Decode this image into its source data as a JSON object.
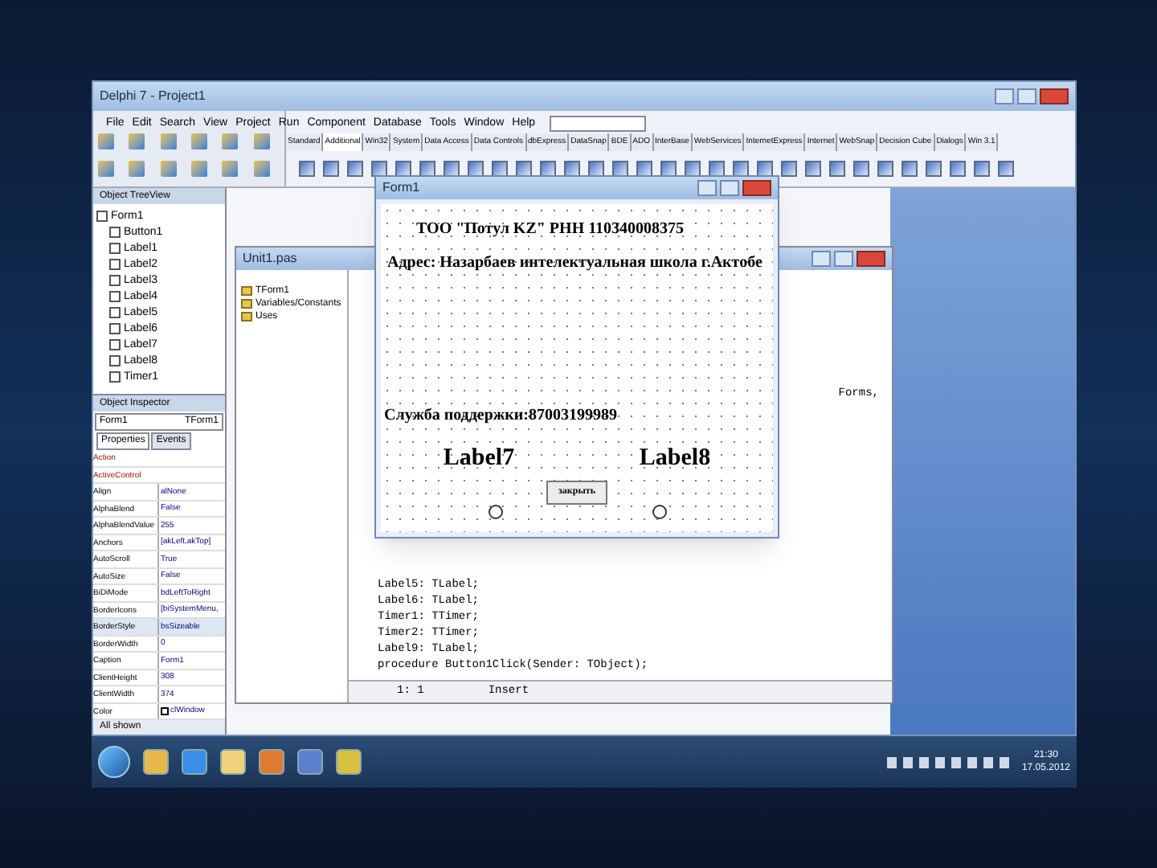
{
  "window": {
    "title": "Delphi 7 - Project1"
  },
  "menu": [
    "File",
    "Edit",
    "Search",
    "View",
    "Project",
    "Run",
    "Component",
    "Database",
    "Tools",
    "Window",
    "Help"
  ],
  "palette_tabs": [
    {
      "label": "Standard",
      "selected": false
    },
    {
      "label": "Additional",
      "selected": true
    },
    {
      "label": "Win32",
      "selected": false
    },
    {
      "label": "System",
      "selected": false
    },
    {
      "label": "Data Access",
      "selected": false
    },
    {
      "label": "Data Controls",
      "selected": false
    },
    {
      "label": "dbExpress",
      "selected": false
    },
    {
      "label": "DataSnap",
      "selected": false
    },
    {
      "label": "BDE",
      "selected": false
    },
    {
      "label": "ADO",
      "selected": false
    },
    {
      "label": "InterBase",
      "selected": false
    },
    {
      "label": "WebServices",
      "selected": false
    },
    {
      "label": "InternetExpress",
      "selected": false
    },
    {
      "label": "Internet",
      "selected": false
    },
    {
      "label": "WebSnap",
      "selected": false
    },
    {
      "label": "Decision Cube",
      "selected": false
    },
    {
      "label": "Dialogs",
      "selected": false
    },
    {
      "label": "Win 3.1",
      "selected": false
    }
  ],
  "object_treeview": {
    "title": "Object TreeView",
    "items": [
      {
        "label": "Form1",
        "children": [
          {
            "label": "Button1"
          },
          {
            "label": "Label1"
          },
          {
            "label": "Label2"
          },
          {
            "label": "Label3"
          },
          {
            "label": "Label4"
          },
          {
            "label": "Label5"
          },
          {
            "label": "Label6"
          },
          {
            "label": "Label7"
          },
          {
            "label": "Label8"
          },
          {
            "label": "Timer1"
          }
        ]
      }
    ]
  },
  "object_inspector": {
    "title": "Object Inspector",
    "object": "Form1",
    "class": "TForm1",
    "tabs": [
      {
        "label": "Properties",
        "selected": true
      },
      {
        "label": "Events",
        "selected": false
      }
    ],
    "properties": [
      {
        "name": "Action",
        "kind": "link"
      },
      {
        "name": "ActiveControl",
        "kind": "link"
      },
      {
        "name": "Align",
        "value": "alNone",
        "kind": "plain"
      },
      {
        "name": "AlphaBlend",
        "value": "False",
        "kind": "plain"
      },
      {
        "name": "AlphaBlendValue",
        "value": "255",
        "kind": "plain"
      },
      {
        "name": "Anchors",
        "value": "[akLeft,akTop]",
        "kind": "set"
      },
      {
        "name": "AutoScroll",
        "value": "True",
        "kind": "plain"
      },
      {
        "name": "AutoSize",
        "value": "False",
        "kind": "plain"
      },
      {
        "name": "BiDiMode",
        "value": "bdLeftToRight",
        "kind": "plain"
      },
      {
        "name": "BorderIcons",
        "value": "[biSystemMenu,",
        "kind": "set"
      },
      {
        "name": "BorderStyle",
        "value": "bsSizeable",
        "kind": "selected"
      },
      {
        "name": "BorderWidth",
        "value": "0",
        "kind": "plain"
      },
      {
        "name": "Caption",
        "value": "Form1",
        "kind": "plain"
      },
      {
        "name": "ClientHeight",
        "value": "308",
        "kind": "plain"
      },
      {
        "name": "ClientWidth",
        "value": "374",
        "kind": "plain"
      },
      {
        "name": "Color",
        "value": "clWindow",
        "kind": "color"
      }
    ],
    "status": "All shown"
  },
  "code_explorer": {
    "title": "Unit1.pas",
    "items": [
      "TForm1",
      "Variables/Constants",
      "Uses"
    ]
  },
  "editor": {
    "lines": [
      "Label5: TLabel;",
      "Label6: TLabel;",
      "Timer1: TTimer;",
      "Timer2: TTimer;",
      "Label9: TLabel;",
      "procedure Button1Click(Sender: TObject);"
    ],
    "trailing_text": "Forms,",
    "position": "1: 1",
    "mode": "Insert"
  },
  "form": {
    "title": "Form1",
    "labels": [
      "ТОО \"Потул KZ\" РНН 110340008375",
      "Адрес: Назарбаев интелектуальная школа г.Актобе",
      "Служба поддержки:87003199989"
    ],
    "label7": "Label7",
    "label8": "Label8",
    "button": "закрыть"
  },
  "taskbar": {
    "time": "21:30",
    "date": "17.05.2012"
  }
}
